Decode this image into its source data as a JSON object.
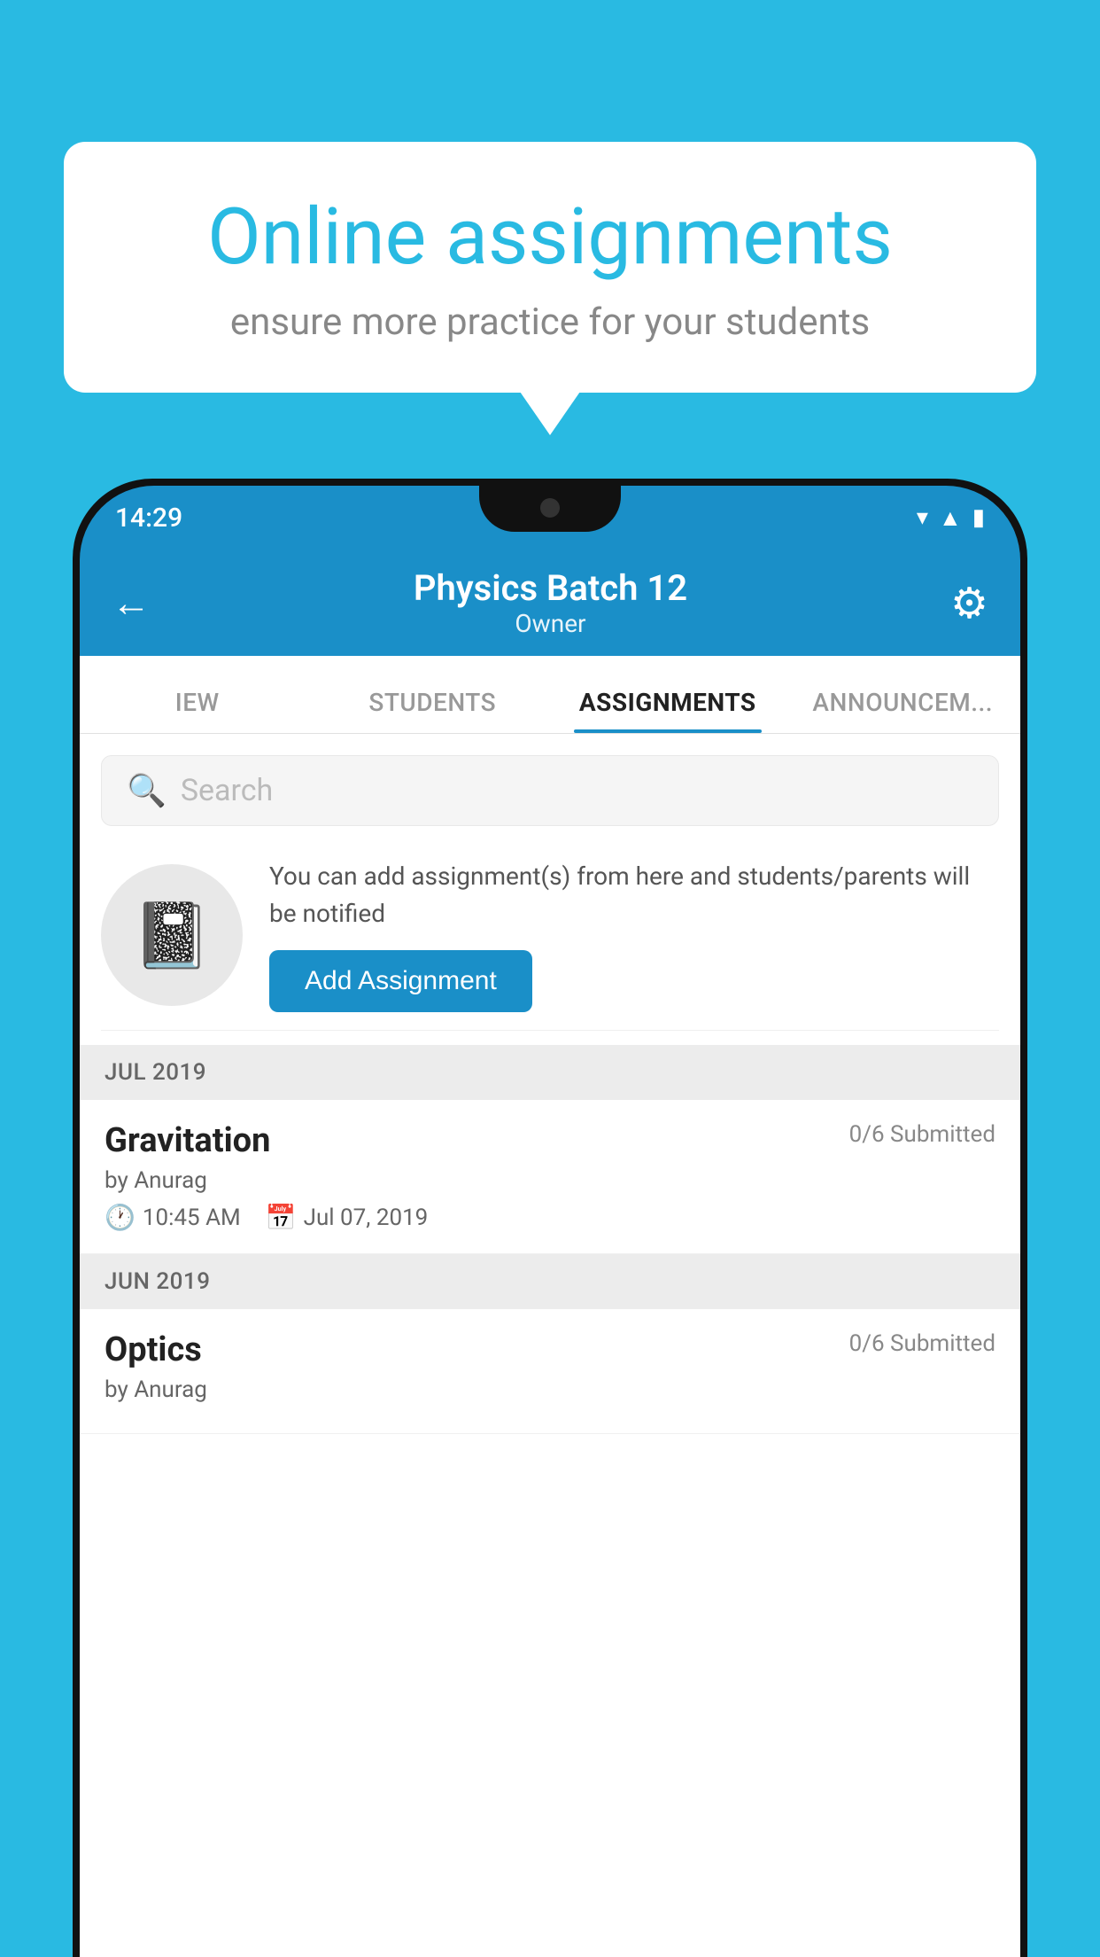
{
  "background_color": "#29bae2",
  "speech_bubble": {
    "title": "Online assignments",
    "subtitle": "ensure more practice for your students"
  },
  "status_bar": {
    "time": "14:29",
    "wifi_icon": "▾",
    "signal_icon": "▲",
    "battery_icon": "▮"
  },
  "header": {
    "title": "Physics Batch 12",
    "subtitle": "Owner",
    "back_label": "←",
    "settings_label": "⚙"
  },
  "tabs": [
    {
      "label": "IEW",
      "active": false
    },
    {
      "label": "STUDENTS",
      "active": false
    },
    {
      "label": "ASSIGNMENTS",
      "active": true
    },
    {
      "label": "ANNOUNCEM...",
      "active": false
    }
  ],
  "search": {
    "placeholder": "Search"
  },
  "promo": {
    "description": "You can add assignment(s) from here and students/parents will be notified",
    "button_label": "Add Assignment"
  },
  "sections": [
    {
      "month": "JUL 2019",
      "assignments": [
        {
          "name": "Gravitation",
          "submitted": "0/6 Submitted",
          "by": "by Anurag",
          "time": "10:45 AM",
          "date": "Jul 07, 2019"
        }
      ]
    },
    {
      "month": "JUN 2019",
      "assignments": [
        {
          "name": "Optics",
          "submitted": "0/6 Submitted",
          "by": "by Anurag",
          "time": "",
          "date": ""
        }
      ]
    }
  ]
}
